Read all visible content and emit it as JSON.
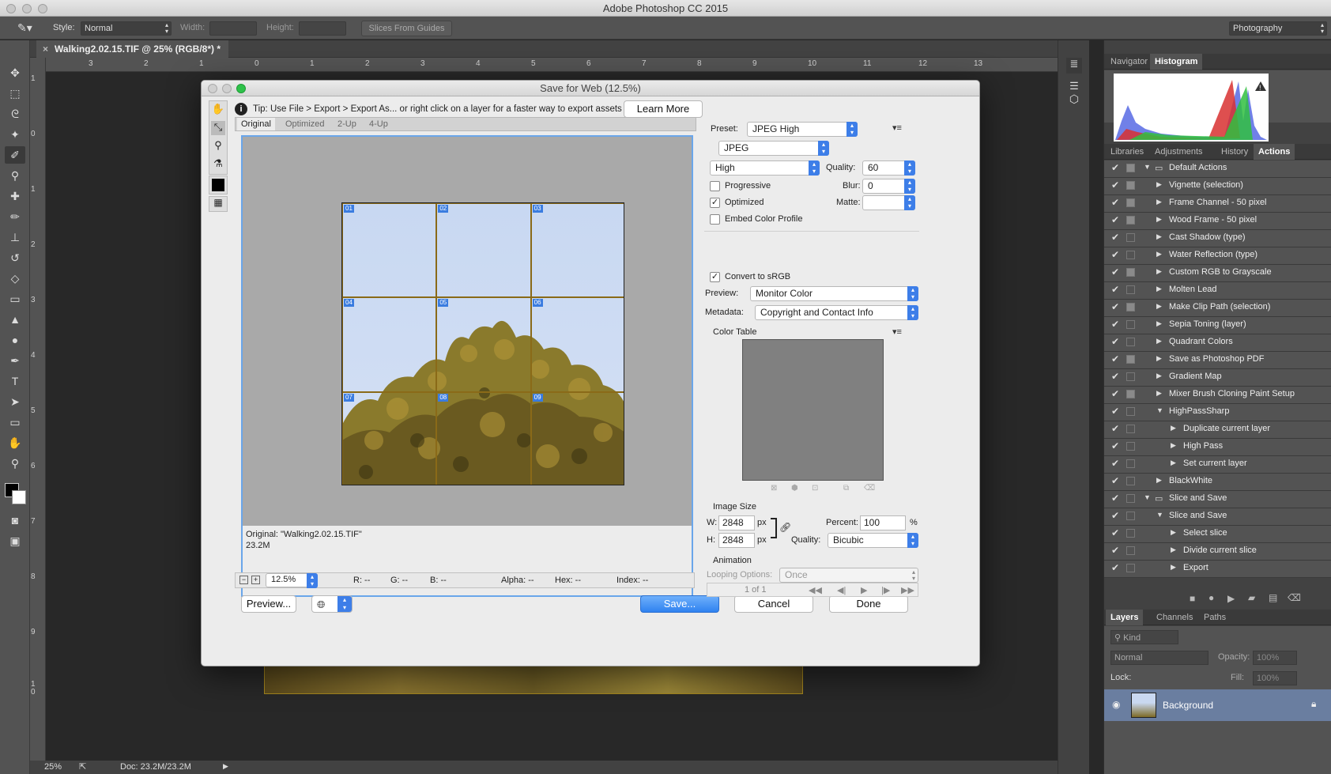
{
  "app": {
    "title": "Adobe Photoshop CC 2015"
  },
  "options_bar": {
    "style_label": "Style:",
    "style_value": "Normal",
    "width_label": "Width:",
    "height_label": "Height:",
    "slices_button": "Slices From Guides",
    "workspace": "Photography"
  },
  "document": {
    "tab": "Walking2.02.15.TIF @ 25% (RGB/8*) *",
    "hruler": [
      "3",
      "2",
      "1",
      "0",
      "1",
      "2",
      "3",
      "4",
      "5",
      "6",
      "7",
      "8",
      "9",
      "10",
      "11",
      "12",
      "13"
    ],
    "vruler": [
      "1",
      "0",
      "1",
      "2",
      "3",
      "4",
      "5",
      "6",
      "7",
      "8",
      "9",
      "1\n0"
    ]
  },
  "status": {
    "zoom": "25%",
    "doc": "Doc: 23.2M/23.2M"
  },
  "dialog": {
    "title": "Save for Web (12.5%)",
    "tip": "Tip: Use File > Export > Export As...  or right click on a layer for a faster way to export assets",
    "learn_more": "Learn More",
    "tabs": [
      "Original",
      "Optimized",
      "2-Up",
      "4-Up"
    ],
    "slice_ids": [
      "01",
      "02",
      "03",
      "04",
      "05",
      "06",
      "07",
      "08",
      "09"
    ],
    "info_name": "Original: \"Walking2.02.15.TIF\"",
    "info_size": "23.2M",
    "zoom_value": "12.5%",
    "readout": {
      "r": "R: --",
      "g": "G: --",
      "b": "B: --",
      "alpha": "Alpha: --",
      "hex": "Hex: --",
      "index": "Index: --"
    },
    "preview_button": "Preview...",
    "save_button": "Save...",
    "cancel_button": "Cancel",
    "done_button": "Done",
    "settings": {
      "preset_label": "Preset:",
      "preset": "JPEG High",
      "format": "JPEG",
      "quality_level": "High",
      "quality_label": "Quality:",
      "quality": "60",
      "blur_label": "Blur:",
      "blur": "0",
      "matte_label": "Matte:",
      "progressive": "Progressive",
      "optimized": "Optimized",
      "embed_profile": "Embed Color Profile",
      "convert_srgb": "Convert to sRGB",
      "preview_label": "Preview:",
      "preview": "Monitor Color",
      "metadata_label": "Metadata:",
      "metadata": "Copyright and Contact Info",
      "color_table": "Color Table",
      "image_size": "Image Size",
      "w_label": "W:",
      "w": "2848",
      "h_label": "H:",
      "h": "2848",
      "px": "px",
      "percent_label": "Percent:",
      "percent": "100",
      "pct": "%",
      "resample_label": "Quality:",
      "resample": "Bicubic",
      "animation": "Animation",
      "looping_label": "Looping Options:",
      "looping": "Once",
      "frame": "1 of 1"
    },
    "checks": {
      "progressive": false,
      "optimized": true,
      "embed_profile": false,
      "convert_srgb": true
    }
  },
  "panels": {
    "nav_tabs": [
      "Navigator",
      "Histogram"
    ],
    "lib_tabs": [
      "Libraries",
      "Adjustments",
      "History",
      "Actions"
    ],
    "actions": [
      {
        "label": "Default Actions",
        "depth": 0,
        "folder": true,
        "open": true,
        "box": true
      },
      {
        "label": "Vignette (selection)",
        "depth": 1,
        "box": true
      },
      {
        "label": "Frame Channel - 50 pixel",
        "depth": 1,
        "box": true
      },
      {
        "label": "Wood Frame - 50 pixel",
        "depth": 1,
        "box": true
      },
      {
        "label": "Cast Shadow (type)",
        "depth": 1,
        "box": false
      },
      {
        "label": "Water Reflection (type)",
        "depth": 1,
        "box": false
      },
      {
        "label": "Custom RGB to Grayscale",
        "depth": 1,
        "box": true
      },
      {
        "label": "Molten Lead",
        "depth": 1,
        "box": false
      },
      {
        "label": "Make Clip Path (selection)",
        "depth": 1,
        "box": true
      },
      {
        "label": "Sepia Toning (layer)",
        "depth": 1,
        "box": false
      },
      {
        "label": "Quadrant Colors",
        "depth": 1,
        "box": false
      },
      {
        "label": "Save as Photoshop PDF",
        "depth": 1,
        "box": true
      },
      {
        "label": "Gradient Map",
        "depth": 1,
        "box": false
      },
      {
        "label": "Mixer Brush Cloning Paint Setup",
        "depth": 1,
        "box": true
      },
      {
        "label": "HighPassSharp",
        "depth": 1,
        "open": true,
        "box": false
      },
      {
        "label": "Duplicate current layer",
        "depth": 2,
        "box": false
      },
      {
        "label": "High Pass",
        "depth": 2,
        "box": false
      },
      {
        "label": "Set current layer",
        "depth": 2,
        "box": false
      },
      {
        "label": "BlackWhite",
        "depth": 1,
        "box": false
      },
      {
        "label": "Slice and Save",
        "depth": 0,
        "folder": true,
        "open": true,
        "box": false
      },
      {
        "label": "Slice and Save",
        "depth": 1,
        "open": true,
        "box": false
      },
      {
        "label": "Select slice",
        "depth": 2,
        "box": false
      },
      {
        "label": "Divide current slice",
        "depth": 2,
        "box": false
      },
      {
        "label": "Export",
        "depth": 2,
        "box": false
      }
    ],
    "layer_tabs": [
      "Layers",
      "Channels",
      "Paths"
    ],
    "kind": "Kind",
    "blend": "Normal",
    "opacity_label": "Opacity:",
    "opacity": "100%",
    "lock_label": "Lock:",
    "fill_label": "Fill:",
    "fill": "100%",
    "layer_name": "Background"
  }
}
